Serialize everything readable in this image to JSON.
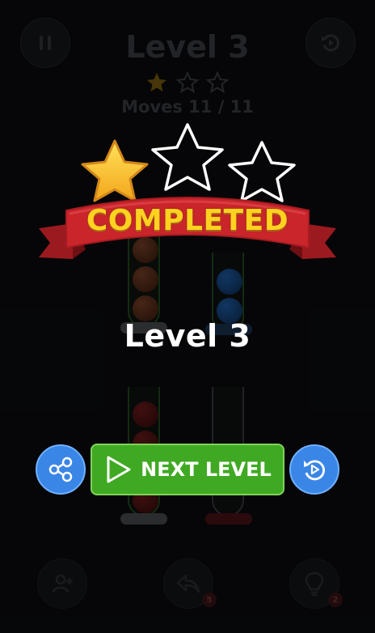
{
  "header": {
    "level_title": "Level 3",
    "stars_earned": 1,
    "stars_total": 3,
    "moves_text": "Moves 11 / 11"
  },
  "popup": {
    "banner_text": "COMPLETED",
    "level_text": "Level 3",
    "next_label": "NEXT LEVEL",
    "stars_earned": 1,
    "stars_total": 3
  },
  "bottom_bar": {
    "undo_count": "5",
    "hint_count": "2"
  },
  "icons": {
    "pause": "pause-icon",
    "restart": "restart-icon",
    "share": "share-icon",
    "play": "play-icon",
    "add_tube": "add-tube-icon",
    "undo": "undo-icon",
    "hint": "lightbulb-icon"
  },
  "colors": {
    "banner_red": "#c9252b",
    "banner_text": "#ffd21f",
    "next_green": "#40a923",
    "round_blue": "#3a86e6",
    "star_gold": "#ffc928"
  }
}
